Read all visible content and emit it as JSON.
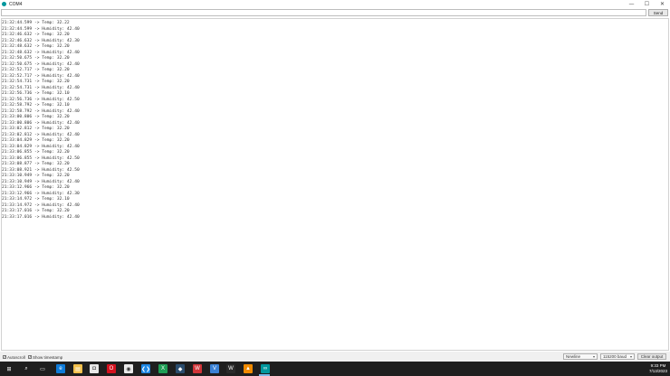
{
  "window": {
    "title": "COM4",
    "minimize": "—",
    "maximize": "☐",
    "close": "✕"
  },
  "send": {
    "input_value": "",
    "button": "Send"
  },
  "log": [
    "21:32:44.599 -> Temp: 32.22",
    "21:32:44.599 -> Humidity: 42.40",
    "21:32:46.632 -> Temp: 32.20",
    "21:32:46.632 -> Humidity: 42.30",
    "21:32:48.632 -> Temp: 32.20",
    "21:32:48.632 -> Humidity: 42.40",
    "21:32:50.675 -> Temp: 32.20",
    "21:32:50.675 -> Humidity: 42.40",
    "21:32:52.717 -> Temp: 32.20",
    "21:32:52.717 -> Humidity: 42.40",
    "21:32:54.731 -> Temp: 32.20",
    "21:32:54.731 -> Humidity: 42.40",
    "21:32:56.736 -> Temp: 32.10",
    "21:32:56.736 -> Humidity: 42.50",
    "21:32:58.792 -> Temp: 32.10",
    "21:32:58.792 -> Humidity: 42.40",
    "21:33:00.806 -> Temp: 32.20",
    "21:33:00.806 -> Humidity: 42.40",
    "21:33:02.812 -> Temp: 32.20",
    "21:33:02.812 -> Humidity: 42.40",
    "21:33:04.829 -> Temp: 32.20",
    "21:33:04.829 -> Humidity: 42.40",
    "21:33:06.855 -> Temp: 32.20",
    "21:33:06.855 -> Humidity: 42.50",
    "21:33:08.877 -> Temp: 32.20",
    "21:33:08.921 -> Humidity: 42.50",
    "21:33:10.949 -> Temp: 32.20",
    "21:33:10.949 -> Humidity: 42.40",
    "21:33:12.966 -> Temp: 32.20",
    "21:33:12.966 -> Humidity: 42.30",
    "21:33:14.972 -> Temp: 32.10",
    "21:33:14.972 -> Humidity: 42.40",
    "21:33:17.016 -> Temp: 32.20",
    "21:33:17.016 -> Humidity: 42.40"
  ],
  "bottom": {
    "autoscroll": "Autoscroll",
    "autoscroll_checked": true,
    "timestamp": "Show timestamp",
    "timestamp_checked": true,
    "line_ending": "Newline",
    "baud": "115200 baud",
    "clear": "Clear output"
  },
  "taskbar": {
    "icons": [
      "windows-start-icon",
      "search-icon",
      "task-view-icon",
      "edge-icon",
      "file-explorer-icon",
      "store-icon",
      "office-icon",
      "opera-icon",
      "chrome-icon",
      "vscode-icon",
      "excel-icon",
      "msedge-dev-icon",
      "visio-icon",
      "wps-icon",
      "winamp-icon",
      "vlc-icon",
      "arduino-icon"
    ],
    "time": "9:33 PM",
    "date": "7/13/2023"
  },
  "colors": {
    "accent": "#00979d",
    "taskbar": "#1f1f1f"
  }
}
